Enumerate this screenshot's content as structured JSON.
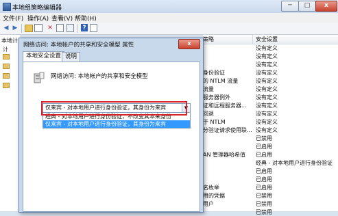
{
  "window": {
    "title": "本地组策略编辑器"
  },
  "window_controls": {
    "minimize": "─",
    "maximize": "□",
    "close": "x"
  },
  "menu": [
    "文件(F)",
    "操作(A)",
    "查看(V)",
    "帮助(H)"
  ],
  "toolbar_glyphs": {
    "back": "◀",
    "forward": "▶",
    "delete": "✕",
    "help": "?"
  },
  "left_pane": {
    "header": "本地计",
    "tree_prefix": "计"
  },
  "right_pane": {
    "columns": [
      "策略",
      "安全设置"
    ],
    "rows": [
      {
        "policy": "",
        "setting": "没有定义"
      },
      {
        "policy": "",
        "setting": "没有定义"
      },
      {
        "policy": "",
        "setting": "没有定义"
      },
      {
        "policy": "身份验证",
        "setting": "没有定义"
      },
      {
        "policy": "的 NTLM 流量",
        "setting": "没有定义"
      },
      {
        "policy": "流量",
        "setting": "没有定义"
      },
      {
        "policy": "服务器例外",
        "setting": "没有定义"
      },
      {
        "policy": "证和远程服务器...",
        "setting": "没有定义"
      },
      {
        "policy": "回退",
        "setting": "没有定义"
      },
      {
        "policy": "于 NTLM",
        "setting": "没有定义"
      },
      {
        "policy": "分验证请求使用联...",
        "setting": "没有定义"
      },
      {
        "policy": "",
        "setting": "已禁用"
      },
      {
        "policy": "",
        "setting": "已启用"
      },
      {
        "policy": "AN 管理器哈希值",
        "setting": "已启用"
      },
      {
        "policy": "",
        "setting": "经典 - 对本地用户进行身份验证"
      },
      {
        "policy": "",
        "setting": "已启用"
      },
      {
        "policy": "",
        "setting": "已启用"
      },
      {
        "policy": "名枚举",
        "setting": "已启用"
      },
      {
        "policy": "用的凭据",
        "setting": "已禁用"
      },
      {
        "policy": "用户",
        "setting": "已禁用"
      },
      {
        "policy": "",
        "setting": "已禁用"
      }
    ]
  },
  "dialog": {
    "title": "网络访问: 本地帐户的共享和安全模型 属性",
    "close_label": "x",
    "tabs": [
      "本地安全设置",
      "说明"
    ],
    "policy_name": "网络访问: 本地帐户的共享和安全模型",
    "selected_value": "仅来宾 - 对本地用户进行身份验证，其身份为来宾",
    "options": [
      "经典 - 对本地用户进行身份验证，不改变其本来身份",
      "仅来宾 - 对本地用户进行身份验证，其身份为来宾"
    ]
  }
}
